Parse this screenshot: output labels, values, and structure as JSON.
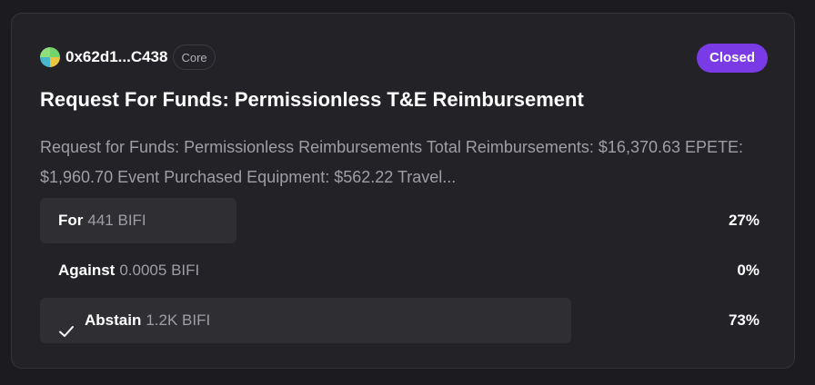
{
  "proposal": {
    "author_address": "0x62d1...C438",
    "author_tag": "Core",
    "status": "Closed",
    "title": "Request For Funds: Permissionless T&E Reimbursement",
    "description": "Request for Funds: Permissionless Reimbursements Total Reimbursements: $16,370.63 EPETE: $1,960.70 Event Purchased Equipment: $562.22 Travel...",
    "status_color": "#7a3be6"
  },
  "votes": [
    {
      "choice": "For",
      "amount": "441 BIFI",
      "percent": "27%",
      "fraction": 0.27,
      "selected": false
    },
    {
      "choice": "Against",
      "amount": "0.0005 BIFI",
      "percent": "0%",
      "fraction": 0.0,
      "selected": false
    },
    {
      "choice": "Abstain",
      "amount": "1.2K BIFI",
      "percent": "73%",
      "fraction": 0.73,
      "selected": true,
      "icon": "check-icon"
    }
  ]
}
